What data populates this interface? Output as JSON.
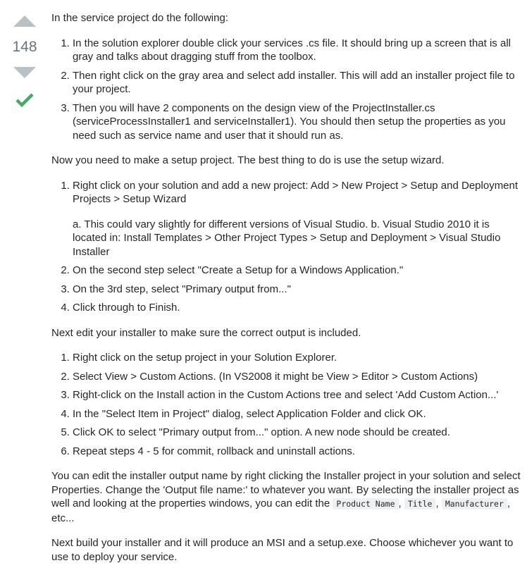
{
  "vote": {
    "count": "148",
    "accent_color": "#48a868",
    "arrow_color": "#bbc0c4"
  },
  "p1": "In the service project do the following:",
  "list1": [
    "In the solution explorer double click your services .cs file. It should bring up a screen that is all gray and talks about dragging stuff from the toolbox.",
    "Then right click on the gray area and select add installer. This will add an installer project file to your project.",
    "Then you will have 2 components on the design view of the ProjectInstaller.cs (serviceProcessInstaller1 and serviceInstaller1). You should then setup the properties as you need such as service name and user that it should run as."
  ],
  "p2": "Now you need to make a setup project. The best thing to do is use the setup wizard.",
  "list2": [
    "Right click on your solution and add a new project: Add > New Project > Setup and Deployment Projects > Setup Wizard",
    "On the second step select \"Create a Setup for a Windows Application.\"",
    "On the 3rd step, select \"Primary output from...\"",
    "Click through to Finish."
  ],
  "list2_sub": "a. This could vary slightly for different versions of Visual Studio. b. Visual Studio 2010 it is located in: Install Templates > Other Project Types > Setup and Deployment > Visual Studio Installer",
  "p3": "Next edit your installer to make sure the correct output is included.",
  "list3": [
    "Right click on the setup project in your Solution Explorer.",
    "Select View > Custom Actions. (In VS2008 it might be View > Editor > Custom Actions)",
    "Right-click on the Install action in the Custom Actions tree and select 'Add Custom Action...'",
    "In the \"Select Item in Project\" dialog, select Application Folder and click OK.",
    "Click OK to select \"Primary output from...\" option. A new node should be created.",
    "Repeat steps 4 - 5 for commit, rollback and uninstall actions."
  ],
  "p4": {
    "text_before": "You can edit the installer output name by right clicking the Installer project in your solution and select Properties. Change the 'Output file name:' to whatever you want. By selecting the installer project as well and looking at the properties windows, you can edit the ",
    "code1": "Product Name",
    "sep1": ", ",
    "code2": "Title",
    "sep2": ", ",
    "code3": "Manufacturer",
    "text_after": ", etc..."
  },
  "p5": "Next build your installer and it will produce an MSI and a setup.exe. Choose whichever you want to use to deploy your service."
}
